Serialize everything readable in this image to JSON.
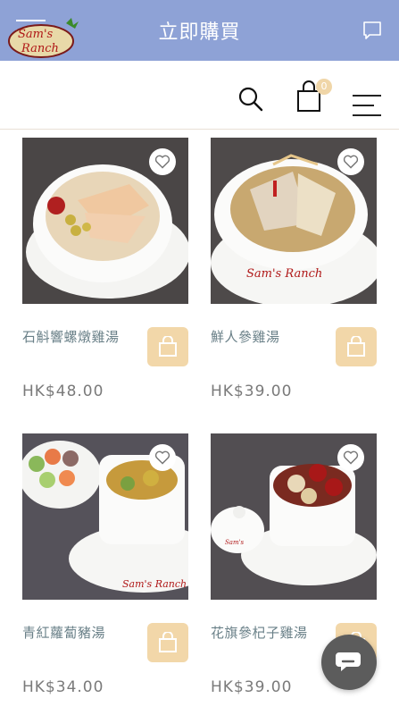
{
  "topbar": {
    "title": "立即購買"
  },
  "header": {
    "brand_name": "Sam's Ranch",
    "cart_count": "0"
  },
  "products": [
    {
      "name": "石斛響螺燉雞湯",
      "price": "HK$48.00"
    },
    {
      "name": "鮮人參雞湯",
      "price": "HK$39.00"
    },
    {
      "name": "青紅蘿蔔豬湯",
      "price": "HK$34.00"
    },
    {
      "name": "花旗參杞子雞湯",
      "price": "HK$39.00"
    }
  ],
  "colors": {
    "topbar": "#8ea2d6",
    "accent": "#f2d7a9",
    "fab": "#5c5c5c"
  }
}
